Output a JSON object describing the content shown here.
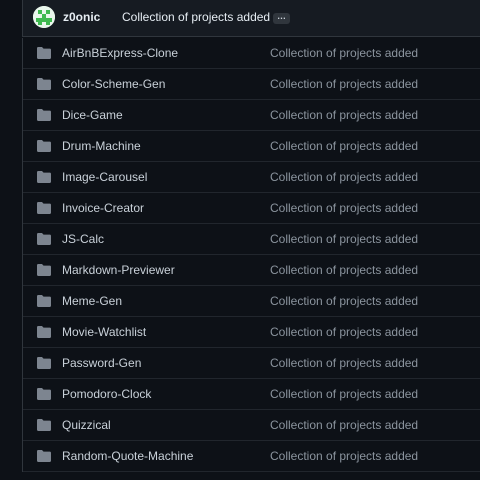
{
  "commit": {
    "author": "z0onic",
    "message": "Collection of projects added",
    "ellipsis": "…"
  },
  "files": [
    {
      "name": "AirBnBExpress-Clone",
      "message": "Collection of projects added",
      "icon": "folder-icon"
    },
    {
      "name": "Color-Scheme-Gen",
      "message": "Collection of projects added",
      "icon": "folder-icon"
    },
    {
      "name": "Dice-Game",
      "message": "Collection of projects added",
      "icon": "folder-icon"
    },
    {
      "name": "Drum-Machine",
      "message": "Collection of projects added",
      "icon": "folder-icon"
    },
    {
      "name": "Image-Carousel",
      "message": "Collection of projects added",
      "icon": "folder-icon"
    },
    {
      "name": "Invoice-Creator",
      "message": "Collection of projects added",
      "icon": "folder-icon"
    },
    {
      "name": "JS-Calc",
      "message": "Collection of projects added",
      "icon": "folder-icon"
    },
    {
      "name": "Markdown-Previewer",
      "message": "Collection of projects added",
      "icon": "folder-icon"
    },
    {
      "name": "Meme-Gen",
      "message": "Collection of projects added",
      "icon": "folder-icon"
    },
    {
      "name": "Movie-Watchlist",
      "message": "Collection of projects added",
      "icon": "folder-icon"
    },
    {
      "name": "Password-Gen",
      "message": "Collection of projects added",
      "icon": "folder-icon"
    },
    {
      "name": "Pomodoro-Clock",
      "message": "Collection of projects added",
      "icon": "folder-icon"
    },
    {
      "name": "Quizzical",
      "message": "Collection of projects added",
      "icon": "folder-icon"
    },
    {
      "name": "Random-Quote-Machine",
      "message": "Collection of projects added",
      "icon": "folder-icon"
    }
  ],
  "colors": {
    "background": "#0d1117",
    "folder": "#7d8590",
    "text": "#c9d1d9",
    "muted": "#8b949e"
  }
}
